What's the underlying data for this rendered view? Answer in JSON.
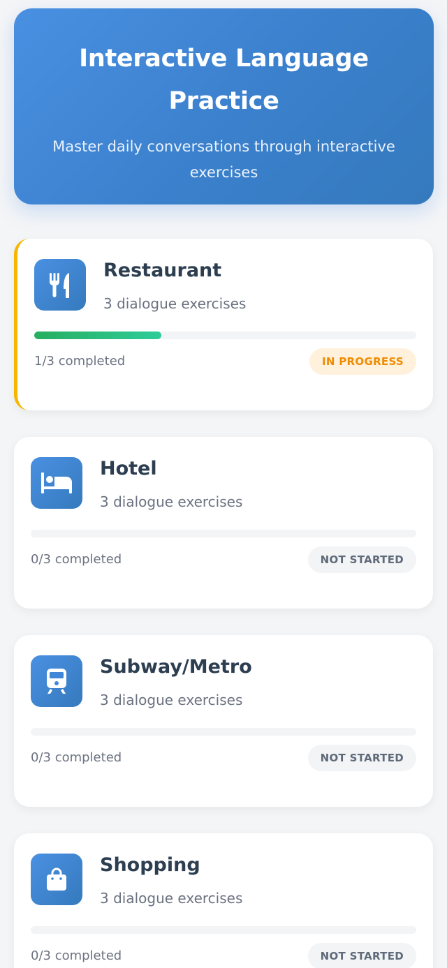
{
  "header": {
    "title": "Interactive Language Practice",
    "subtitle": "Master daily conversations through interactive exercises"
  },
  "colors": {
    "accent": "#4a90e2",
    "accent_dark": "#357abd",
    "in_progress_border": "#f7b500",
    "progress_green": "#27ae60"
  },
  "scenarios": [
    {
      "icon": "utensils-icon",
      "title": "Restaurant",
      "subtitle": "3 dialogue exercises",
      "completed_text": "1/3 completed",
      "progress": 0.333,
      "status": "IN PROGRESS"
    },
    {
      "icon": "bed-icon",
      "title": "Hotel",
      "subtitle": "3 dialogue exercises",
      "completed_text": "0/3 completed",
      "progress": 0,
      "status": "NOT STARTED"
    },
    {
      "icon": "train-icon",
      "title": "Subway/Metro",
      "subtitle": "3 dialogue exercises",
      "completed_text": "0/3 completed",
      "progress": 0,
      "status": "NOT STARTED"
    },
    {
      "icon": "shopping-bag-icon",
      "title": "Shopping",
      "subtitle": "3 dialogue exercises",
      "completed_text": "0/3 completed",
      "progress": 0,
      "status": "NOT STARTED"
    }
  ]
}
